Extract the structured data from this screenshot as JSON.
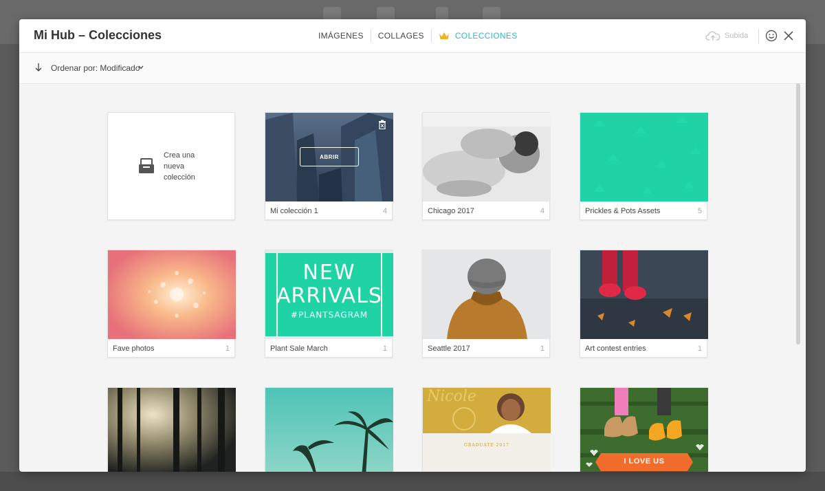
{
  "header": {
    "title": "Mi Hub – Colecciones",
    "tabs": [
      {
        "label": "IMÁGENES",
        "active": false
      },
      {
        "label": "COLLAGES",
        "active": false
      },
      {
        "label": "COLECCIONES",
        "active": true,
        "icon": "crown-icon"
      }
    ],
    "upload_label": "Subida",
    "accent_color": "#2fb8c9",
    "crown_color": "#f0b429"
  },
  "sortbar": {
    "label": "Ordenar por: Modificado"
  },
  "new_collection": {
    "line1": "Crea una",
    "line2": "nueva",
    "line3": "colección",
    "icon": "collection-add-icon"
  },
  "open_button_label": "ABRIR",
  "collections": [
    {
      "name": "Mi colección 1",
      "count": "4",
      "thumb": "city-buildings"
    },
    {
      "name": "Chicago 2017",
      "count": "4",
      "thumb": "bw-couple"
    },
    {
      "name": "Prickles & Pots Assets",
      "count": "5",
      "thumb": "teal-pattern"
    },
    {
      "name": "Fave photos",
      "count": "1",
      "thumb": "bokeh-lights"
    },
    {
      "name": "Plant Sale March",
      "count": "1",
      "thumb": "new-arrivals"
    },
    {
      "name": "Seattle 2017",
      "count": "1",
      "thumb": "person-beanie"
    },
    {
      "name": "Art contest entries",
      "count": "1",
      "thumb": "red-boots"
    },
    {
      "name": "",
      "count": "",
      "thumb": "forest"
    },
    {
      "name": "",
      "count": "",
      "thumb": "palm-trees"
    },
    {
      "name": "",
      "count": "",
      "thumb": "graduate"
    },
    {
      "name": "",
      "count": "",
      "thumb": "i-love-us"
    }
  ],
  "thumb_text": {
    "new_arrivals_line1": "NEW",
    "new_arrivals_line2": "ARRIVALS",
    "new_arrivals_tag": "#PLANTSAGRAM",
    "graduate_name": "Nicole",
    "graduate_caption": "GRADUATE 2017",
    "love_banner": "I LOVE US"
  }
}
